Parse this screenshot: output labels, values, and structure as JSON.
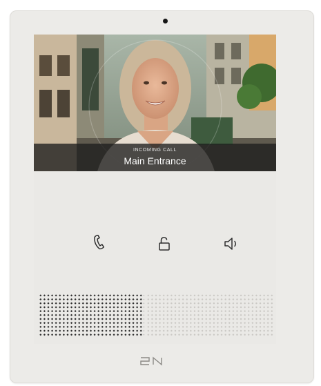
{
  "device": {
    "brand": "2N",
    "colors": {
      "body": "#ecebe8",
      "icon": "#2e2e2e",
      "screen_bar": "#1e1e1e"
    }
  },
  "screen": {
    "call_status": "INCOMING CALL",
    "caller_name": "Main Entrance"
  },
  "buttons": [
    {
      "id": "answer",
      "icon": "phone-icon"
    },
    {
      "id": "unlock",
      "icon": "unlock-icon"
    },
    {
      "id": "volume",
      "icon": "speaker-icon"
    }
  ]
}
